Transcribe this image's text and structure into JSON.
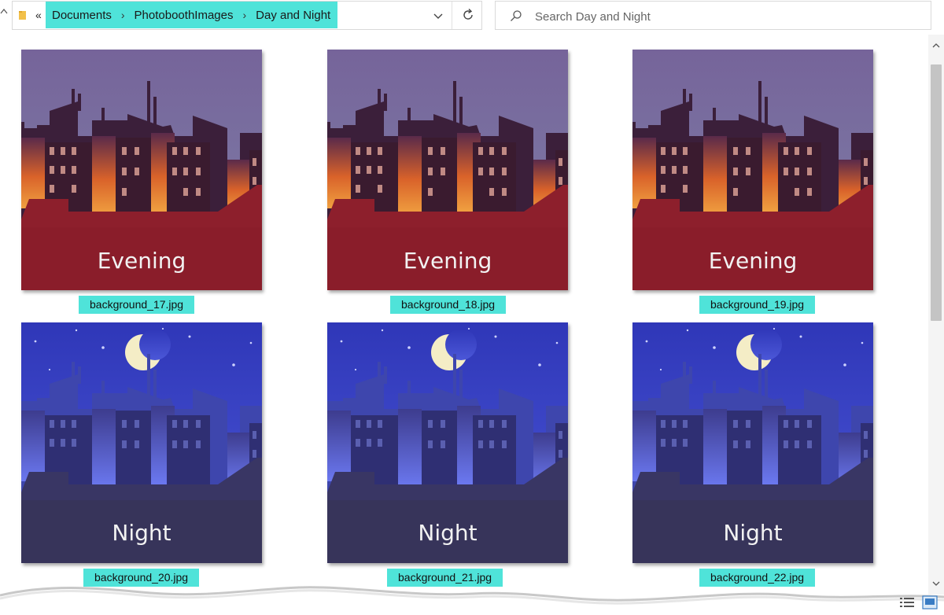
{
  "address_bar": {
    "overflow": "«",
    "breadcrumbs": [
      "Documents",
      "PhotoboothImages",
      "Day and Night"
    ]
  },
  "search": {
    "placeholder": "Search Day and Night"
  },
  "files": [
    {
      "name": "background_17.jpg",
      "caption": "Evening"
    },
    {
      "name": "background_18.jpg",
      "caption": "Evening"
    },
    {
      "name": "background_19.jpg",
      "caption": "Evening"
    },
    {
      "name": "background_20.jpg",
      "caption": "Night"
    },
    {
      "name": "background_21.jpg",
      "caption": "Night"
    },
    {
      "name": "background_22.jpg",
      "caption": "Night"
    }
  ],
  "colors": {
    "highlight": "#4fe3d9",
    "evening_sky": "#7a6a9a",
    "evening_ground": "#8d1f2c",
    "night_sky": "#3b3fc7",
    "night_ground": "#37345a",
    "moon": "#f4edc6"
  },
  "icons": {
    "folder": "folder-icon",
    "dropdown": "chevron-down-icon",
    "refresh": "refresh-icon",
    "search": "search-icon",
    "details_view": "details-view-icon",
    "large_icons_view": "large-icons-view-icon"
  }
}
